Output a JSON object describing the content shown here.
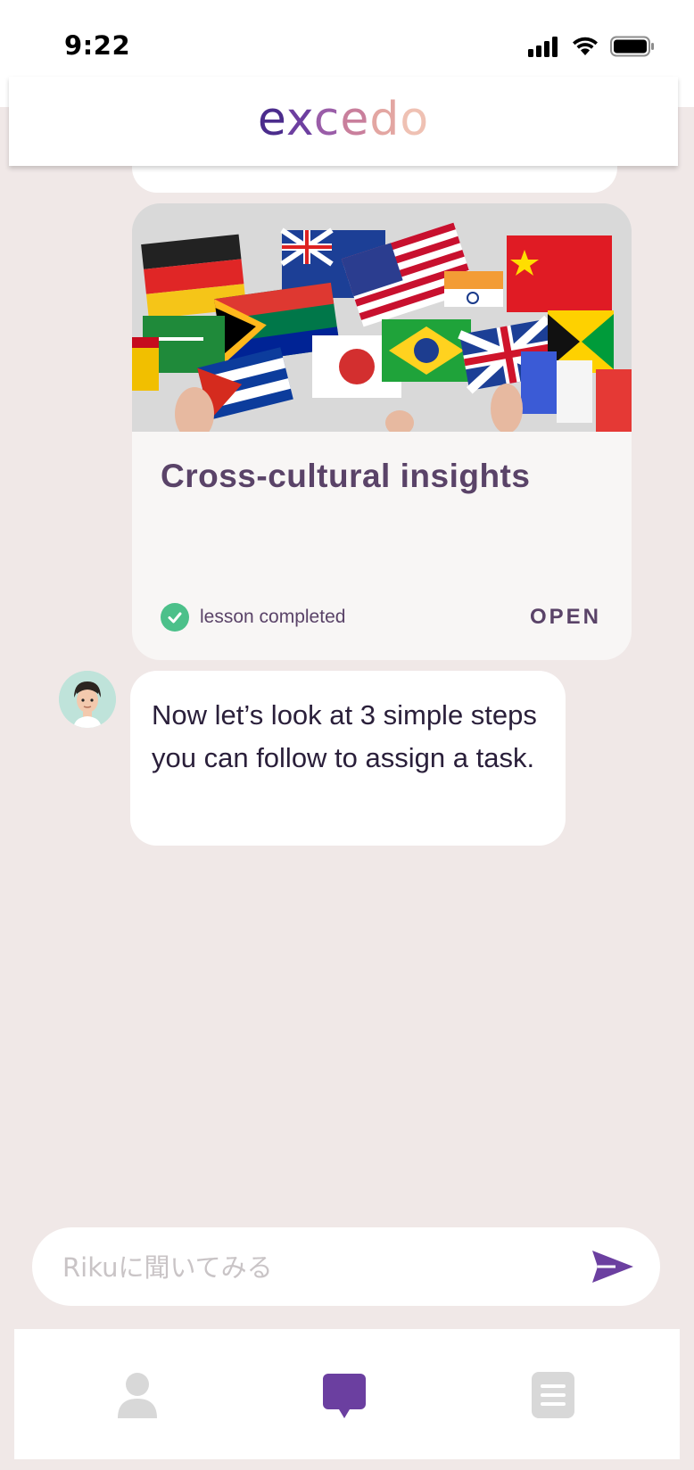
{
  "status_bar": {
    "time": "9:22",
    "icons": [
      "signal-icon",
      "wifi-icon",
      "battery-icon"
    ]
  },
  "header": {
    "logo": "excedo"
  },
  "lesson_card": {
    "image": "flags-image",
    "title": "Cross-cultural insights",
    "status": "lesson completed",
    "status_icon": "check-circle-icon",
    "open_label": "OPEN"
  },
  "message": {
    "avatar": "bot-avatar",
    "text": "Now let’s look at 3 simple steps you can follow to assign a task."
  },
  "input": {
    "placeholder": "Rikuに聞いてみる",
    "value": "",
    "send_icon": "send-icon"
  },
  "tabs": [
    {
      "icon": "person-icon",
      "active": false
    },
    {
      "icon": "chat-icon",
      "active": true
    },
    {
      "icon": "list-icon",
      "active": false
    }
  ],
  "colors": {
    "accent": "#6b3fa0",
    "chat_background": "#f0e8e7",
    "text_dark": "#5a4368",
    "success": "#4cc08a",
    "tab_inactive": "#d8d8d8"
  }
}
